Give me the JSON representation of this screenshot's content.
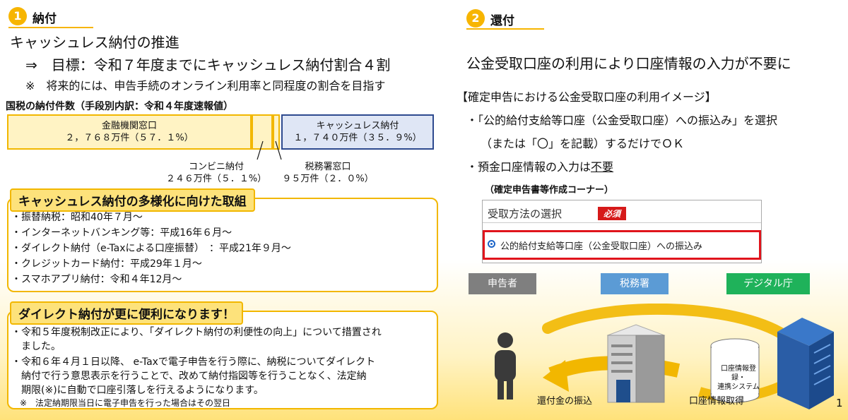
{
  "left": {
    "section_number": "1",
    "section_title": "納付",
    "headline": "キャッシュレス納付の推進",
    "target_line": "⇒　目標：令和７年度までにキャッシュレス納付割合４割",
    "note_line": "※　将来的には、申告手続のオンライン利用率と同程度の割合を目指す",
    "chart_title": "国税の納付件数（手段別内訳：令和４年度速報値）",
    "bars": {
      "bank_label": "金融機関窓口",
      "bank_value": "２，７６８万件（５７．１%）",
      "cashless_label": "キャッシュレス納付",
      "cashless_value": "１，７４０万件（３５．９%）",
      "convenience_label": "コンビニ納付",
      "convenience_value": "２４６万件（５．１%）",
      "taxoffice_label": "税務署窓口",
      "taxoffice_value": "９５万件（２．０%）"
    },
    "diversify_title": "キャッシュレス納付の多様化に向けた取組",
    "diversify_items": [
      "・振替納税：昭和40年７月～",
      "・インターネットバンキング等：平成16年６月～",
      "・ダイレクト納付（e-Taxによる口座振替）　：平成21年９月～",
      "・クレジットカード納付：平成29年１月～",
      "・スマホアプリ納付：令和４年12月～"
    ],
    "direct_title": "ダイレクト納付が更に便利になります！",
    "direct_lines": [
      "・令和５年度税制改正により、「ダイレクト納付の利便性の向上」について措置され",
      "　ました。",
      "・令和６年４月１日以降、 e-Taxで電子申告を行う際に、納税についてダイレクト",
      "　納付で行う意思表示を行うことで、改めて納付指図等を行うことなく、法定納",
      "　期限(※)に自動で口座引落しを行えるようになります。",
      "　※　法定納期限当日に電子申告を行った場合はその翌日"
    ]
  },
  "right": {
    "section_number": "2",
    "section_title": "還付",
    "headline": "公金受取口座の利用により口座情報の入力が不要に",
    "usage_title": "【確定申告における公金受取口座の利用イメージ】",
    "bullet1_line1": "・「公的給付支給等口座（公金受取口座）への振込み」を選択",
    "bullet1_line2": "（または「〇」を記載）するだけでＯＫ",
    "bullet2_prefix": "・預金口座情報の入力は",
    "bullet2_emph": "不要",
    "corner_label": "（確定申告書等作成コーナー）",
    "form_label": "受取方法の選択",
    "required_badge": "必須",
    "radio_option": "公的給付支給等口座（公金受取口座）への振込み",
    "roles": [
      "申告者",
      "税務署",
      "デジタル庁"
    ],
    "role_colors": [
      "#7f7f7f",
      "#5b9bd5",
      "#1fb25a"
    ],
    "cylinder_text_1": "口座情報登録・",
    "cylinder_text_2": "連携システム",
    "caption_refund": "還付金の振込",
    "caption_account": "口座情報取得"
  },
  "page_number": "1"
}
